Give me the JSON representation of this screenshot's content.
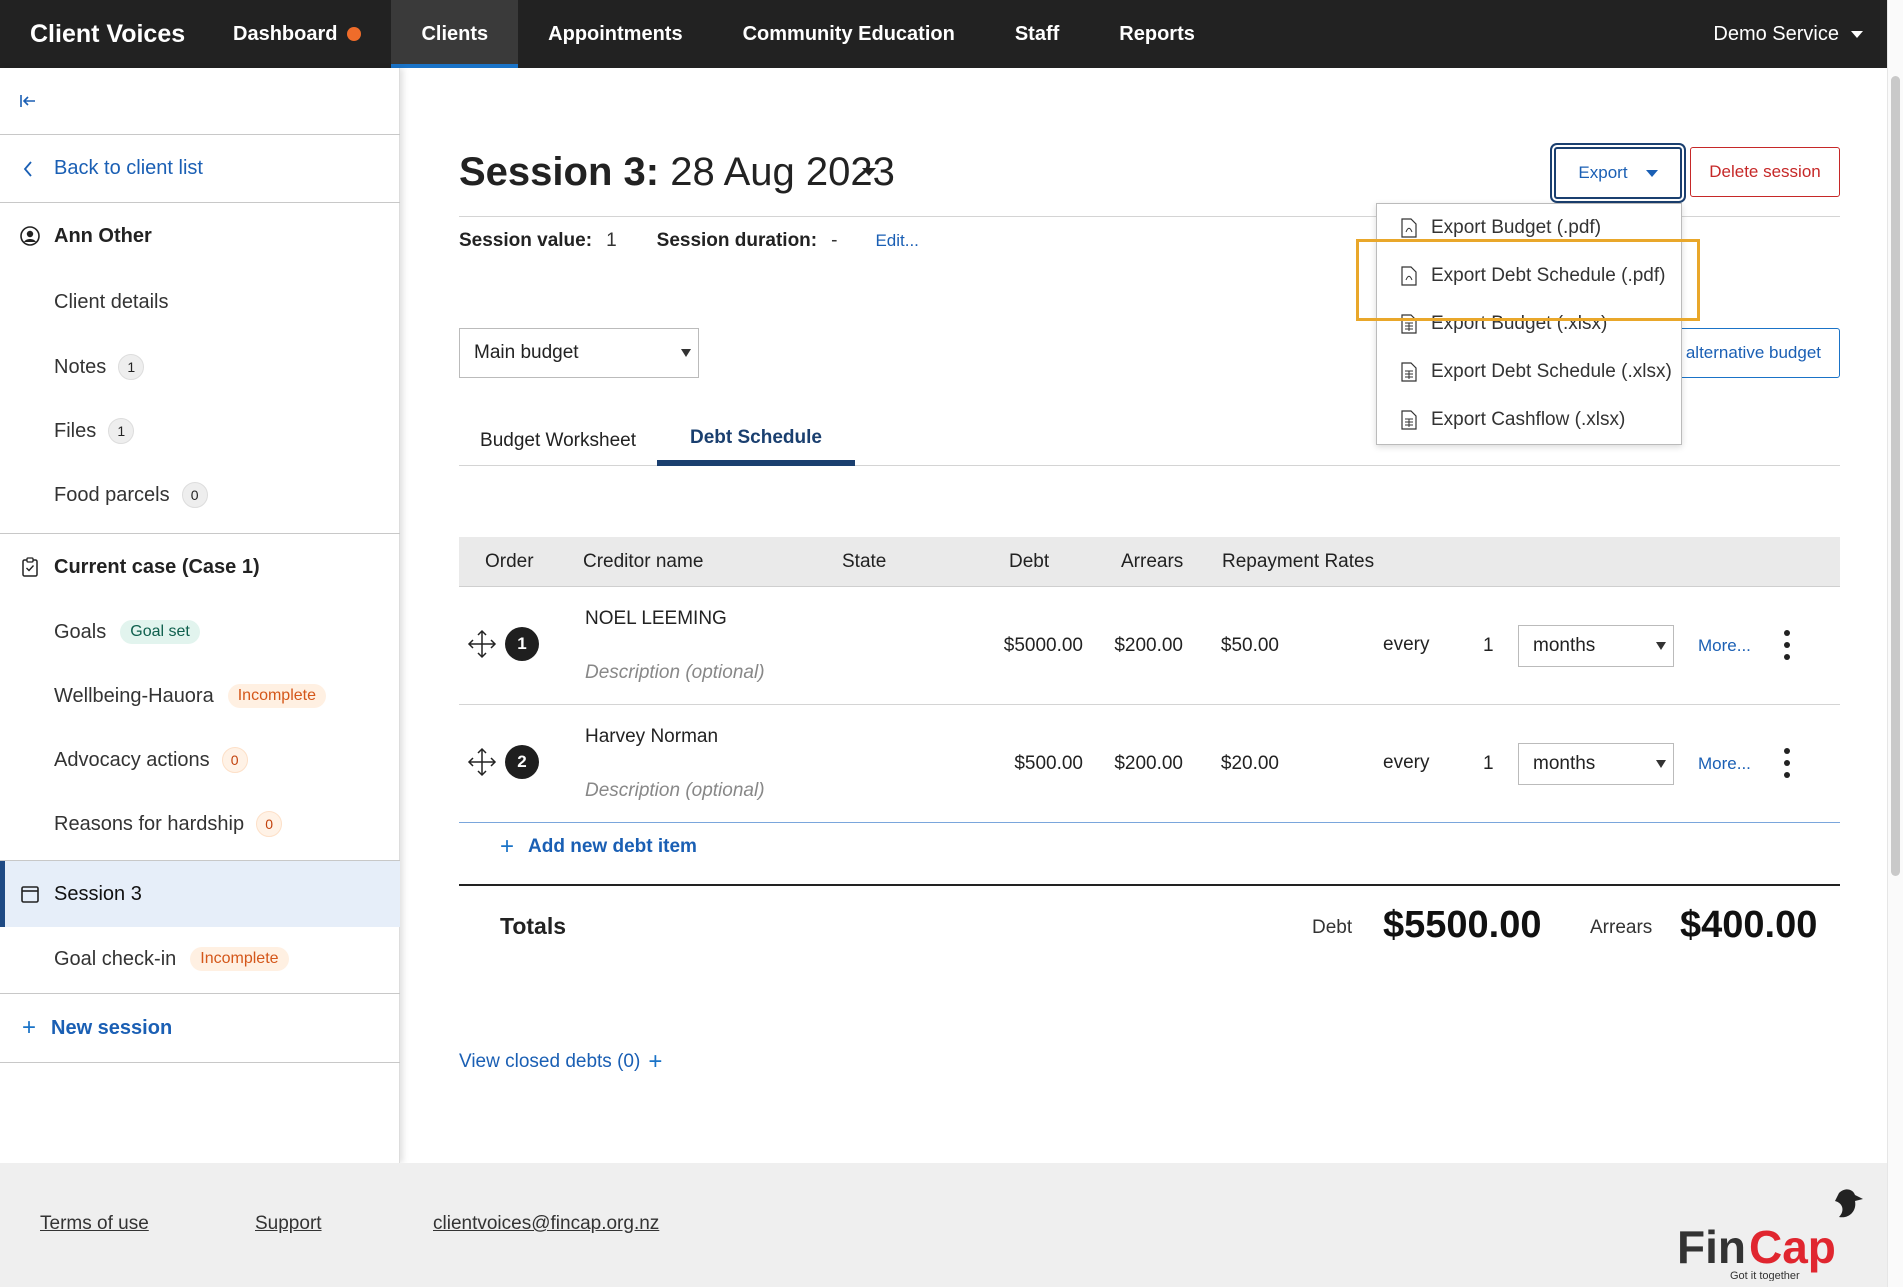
{
  "app": {
    "title": "Client Voices"
  },
  "nav": {
    "items": [
      "Dashboard",
      "Clients",
      "Appointments",
      "Community Education",
      "Staff",
      "Reports"
    ],
    "service": "Demo Service"
  },
  "sidebar": {
    "back": "Back to client list",
    "client_name": "Ann Other",
    "client_details": "Client details",
    "notes": "Notes",
    "notes_count": "1",
    "files": "Files",
    "files_count": "1",
    "food_parcels": "Food parcels",
    "food_parcels_count": "0",
    "current_case": "Current case (Case 1)",
    "goals": "Goals",
    "goals_status": "Goal set",
    "wellbeing": "Wellbeing-Hauora",
    "wellbeing_status": "Incomplete",
    "advocacy": "Advocacy actions",
    "advocacy_count": "0",
    "hardship": "Reasons for hardship",
    "hardship_count": "0",
    "session": "Session 3",
    "goal_checkin": "Goal check-in",
    "goal_checkin_status": "Incomplete",
    "new_session": "New session"
  },
  "session": {
    "title_bold": "Session 3:",
    "title_date": " 28 Aug 2023",
    "value_label": "Session value:",
    "value": "1",
    "duration_label": "Session duration:",
    "duration": "-",
    "edit": "Edit...",
    "export": "Export",
    "delete": "Delete session",
    "budget_select": "Main budget",
    "alt_budget": "alternative budget"
  },
  "tabs": [
    "Budget Worksheet",
    "Debt Schedule"
  ],
  "table": {
    "headers": [
      "Order",
      "Creditor name",
      "State",
      "Debt",
      "Arrears",
      "Repayment Rates"
    ],
    "rows": [
      {
        "order": "1",
        "creditor": "NOEL LEEMING",
        "description": "Description (optional)",
        "debt": "$5000.00",
        "arrears": "$200.00",
        "rate": "$50.00",
        "every": "every",
        "count": "1",
        "unit": "months",
        "more": "More..."
      },
      {
        "order": "2",
        "creditor": "Harvey Norman",
        "description": "Description (optional)",
        "debt": "$500.00",
        "arrears": "$200.00",
        "rate": "$20.00",
        "every": "every",
        "count": "1",
        "unit": "months",
        "more": "More..."
      }
    ],
    "add_item": "Add new debt item"
  },
  "totals": {
    "label": "Totals",
    "debt_label": "Debt",
    "debt": "$5500.00",
    "arrears_label": "Arrears",
    "arrears": "$400.00"
  },
  "view_closed": "View closed debts (0)",
  "export_menu": [
    "Export Budget (.pdf)",
    "Export Debt Schedule (.pdf)",
    "Export Budget (.xlsx)",
    "Export Debt Schedule (.xlsx)",
    "Export Cashflow (.xlsx)"
  ],
  "footer": {
    "terms": "Terms of use",
    "support": "Support",
    "email": "clientvoices@fincap.org.nz",
    "logo_text": "FinCap",
    "logo_tagline": "Got it together"
  },
  "colors": {
    "nav_bg": "#222222",
    "accent": "#1a73c7",
    "danger": "#c62828",
    "highlight": "#e9a72a"
  }
}
